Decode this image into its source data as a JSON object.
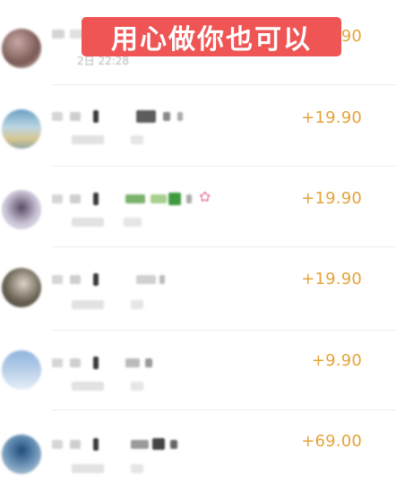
{
  "banner": {
    "text": "用心做你也可以"
  },
  "rows": [
    {
      "amount": "+19.90",
      "time": "2日 22:28"
    },
    {
      "amount": "+19.90"
    },
    {
      "amount": "+19.90",
      "decoration": "cherry-blossom-emoji"
    },
    {
      "amount": "+19.90"
    },
    {
      "amount": "+9.90"
    },
    {
      "amount": "+69.00"
    }
  ],
  "colors": {
    "amount": "#e5a33a",
    "banner_bg": "#ef5555",
    "banner_text": "#ffffff",
    "divider": "#ededed"
  }
}
